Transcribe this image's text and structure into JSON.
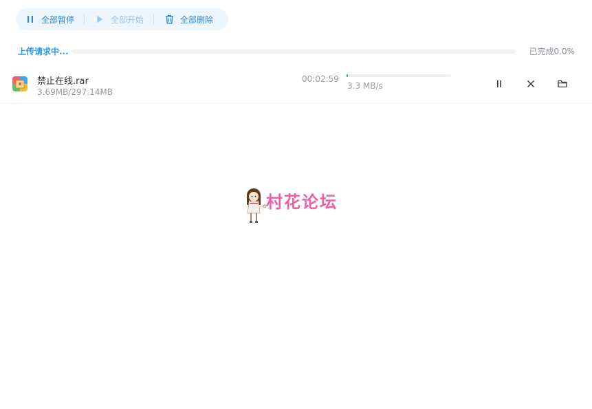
{
  "toolbar": {
    "pause_all": "全部暂停",
    "start_all": "全部开始",
    "delete_all": "全部删除"
  },
  "status": {
    "label": "上传请求中...",
    "done": "已完成0.0%",
    "progress_fraction": 0.0
  },
  "files": [
    {
      "name": "禁止在线.rar",
      "size": "3.69MB/297.14MB",
      "time": "00:02:59",
      "speed": "3.3 MB/s",
      "progress_fraction": 0.0124
    }
  ],
  "watermark": {
    "text": "村花论坛"
  },
  "colors": {
    "accent": "#2a9ae3",
    "toolbar_bg": "#eef6fd",
    "watermark": "#ee5fa7"
  },
  "icons": [
    "pause-icon",
    "play-icon",
    "trash-icon",
    "archive-file-icon",
    "close-icon",
    "folder-icon"
  ]
}
